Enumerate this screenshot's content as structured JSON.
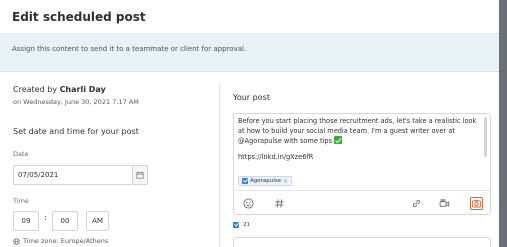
{
  "modal": {
    "title": "Edit scheduled post",
    "info_text": "Assign this content to send it to a teammate or client for approval."
  },
  "left": {
    "created_prefix": "Created by",
    "created_by": "Charli Day",
    "created_date": "on Wednesday, June 30, 2021 7:17 AM",
    "section_title": "Set date and time for your post",
    "date_label": "Date",
    "date_value": "07/05/2021",
    "time_label": "Time",
    "hour": "09",
    "time_separator": ":",
    "minute": "00",
    "ampm": "AM",
    "timezone": "Time zone: Europe/Athens"
  },
  "right": {
    "title": "Your post",
    "post_text": "Before you start placing those recruitment ads, let's take a realistic look at how to build your social media team. I'm a guest writer over at @Agorapulse with some tips",
    "post_link": "https://lnkd.in/gXze6fR",
    "tag_label": "Agorapulse",
    "tag_remove": "×",
    "char_count": "21"
  },
  "colors": {
    "accent_orange": "#e9642a",
    "check_blue": "#2f7fd8",
    "emoji_green": "#3dab3c",
    "info_bg": "#e8f3f9"
  },
  "icons": {
    "emoji": "smiley-icon",
    "hashtag": "hashtag-icon",
    "link": "link-icon",
    "video": "video-camera-icon",
    "media": "camera-icon",
    "calendar": "calendar-icon",
    "timezone": "globe-icon"
  }
}
